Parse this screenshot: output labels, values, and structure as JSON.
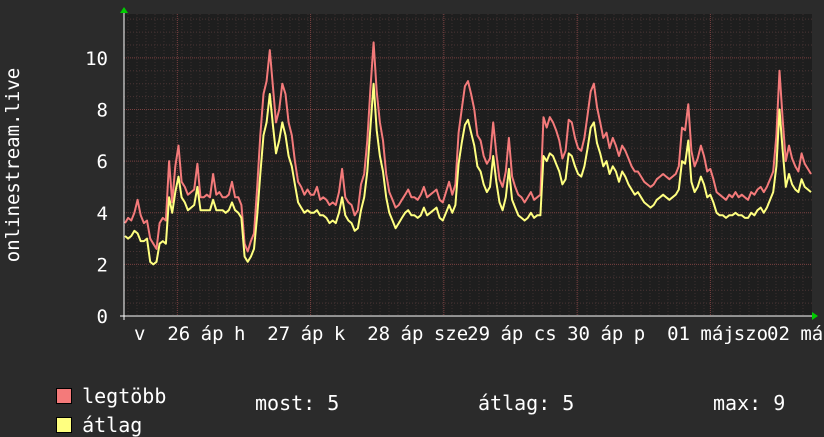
{
  "chart_data": {
    "type": "line",
    "ylabel": "onlinestream.live",
    "ylim": [
      0,
      11.7
    ],
    "yticks": [
      0,
      2,
      4,
      6,
      8,
      10
    ],
    "x_ticks": [
      "v",
      "26",
      "áp",
      "h",
      "27",
      "áp",
      "k",
      "28",
      "áp",
      "sze",
      "29",
      "áp",
      "cs",
      "30",
      "áp",
      "p",
      "01",
      "máj",
      "szo",
      "02",
      "má"
    ],
    "grid": true,
    "legend_position": "bottom-left",
    "series": [
      {
        "name": "legtöbb",
        "color": "#f47a7a",
        "values": [
          3.6,
          3.8,
          3.7,
          4.0,
          4.5,
          3.9,
          3.6,
          3.7,
          3.0,
          2.8,
          2.6,
          3.6,
          3.8,
          3.7,
          6.0,
          4.4,
          5.8,
          6.6,
          5.2,
          5.0,
          4.7,
          4.8,
          4.9,
          5.9,
          4.6,
          4.6,
          4.7,
          4.6,
          5.5,
          4.7,
          4.8,
          4.6,
          4.6,
          4.7,
          5.2,
          4.6,
          4.6,
          4.3,
          2.8,
          2.5,
          2.9,
          3.2,
          5.0,
          7.0,
          8.6,
          9.1,
          10.3,
          8.9,
          7.5,
          8.0,
          9.0,
          8.6,
          7.5,
          7.0,
          6.0,
          5.2,
          5.0,
          4.7,
          4.9,
          4.7,
          4.7,
          5.0,
          4.5,
          4.6,
          4.5,
          4.3,
          4.4,
          4.3,
          4.8,
          5.7,
          4.6,
          4.4,
          4.3,
          3.9,
          4.1,
          5.1,
          5.5,
          6.8,
          8.8,
          10.6,
          8.7,
          7.5,
          6.8,
          5.5,
          4.8,
          4.5,
          4.2,
          4.3,
          4.5,
          4.7,
          4.9,
          4.6,
          4.6,
          4.5,
          4.7,
          5.0,
          4.6,
          4.7,
          4.8,
          4.9,
          4.5,
          4.4,
          4.8,
          5.2,
          4.7,
          5.1,
          7.1,
          8.0,
          8.9,
          9.1,
          8.6,
          8.0,
          7.0,
          6.8,
          6.2,
          5.9,
          6.1,
          7.5,
          6.3,
          5.3,
          5.0,
          5.6,
          6.9,
          5.4,
          5.0,
          4.7,
          4.6,
          4.4,
          4.6,
          4.8,
          4.5,
          4.6,
          4.7,
          7.7,
          7.3,
          7.7,
          7.5,
          7.2,
          6.8,
          6.1,
          6.4,
          7.6,
          7.5,
          6.9,
          6.5,
          6.4,
          6.9,
          7.8,
          8.7,
          9.0,
          8.1,
          7.5,
          6.9,
          7.1,
          6.5,
          6.9,
          6.6,
          6.2,
          6.6,
          6.4,
          6.1,
          5.8,
          5.6,
          5.6,
          5.4,
          5.2,
          5.1,
          5.0,
          5.1,
          5.3,
          5.4,
          5.5,
          5.4,
          5.3,
          5.4,
          5.5,
          5.8,
          7.3,
          7.2,
          8.2,
          6.4,
          5.8,
          6.1,
          6.6,
          6.2,
          5.6,
          5.7,
          5.3,
          4.8,
          4.7,
          4.6,
          4.5,
          4.7,
          4.6,
          4.8,
          4.6,
          4.7,
          4.6,
          4.5,
          4.8,
          4.7,
          4.9,
          5.0,
          4.8,
          5.0,
          5.3,
          5.6,
          7.0,
          9.5,
          7.6,
          6.0,
          6.6,
          6.1,
          5.8,
          5.6,
          6.3,
          5.9,
          5.7,
          5.5
        ]
      },
      {
        "name": "átlag",
        "color": "#ffff80",
        "values": [
          3.1,
          3.0,
          3.1,
          3.3,
          3.2,
          2.9,
          2.9,
          3.0,
          2.1,
          2.0,
          2.1,
          2.8,
          2.9,
          2.8,
          4.6,
          4.0,
          4.8,
          5.4,
          4.6,
          4.4,
          4.1,
          4.2,
          4.3,
          5.0,
          4.1,
          4.1,
          4.1,
          4.1,
          4.5,
          4.1,
          4.1,
          4.1,
          4.0,
          4.1,
          4.4,
          4.1,
          4.0,
          3.8,
          2.3,
          2.1,
          2.3,
          2.6,
          3.9,
          5.5,
          7.0,
          7.5,
          8.6,
          7.4,
          6.3,
          6.8,
          7.5,
          7.0,
          6.2,
          5.8,
          5.1,
          4.4,
          4.2,
          4.0,
          4.1,
          4.0,
          4.0,
          4.1,
          3.9,
          3.9,
          3.8,
          3.6,
          3.7,
          3.6,
          4.0,
          4.6,
          3.9,
          3.7,
          3.6,
          3.3,
          3.4,
          4.1,
          4.6,
          5.6,
          7.3,
          9.0,
          7.2,
          6.2,
          5.6,
          4.6,
          4.0,
          3.7,
          3.4,
          3.6,
          3.8,
          4.0,
          4.1,
          3.9,
          3.9,
          3.8,
          3.9,
          4.2,
          3.9,
          4.0,
          4.1,
          4.2,
          3.8,
          3.7,
          4.0,
          4.3,
          4.0,
          4.3,
          5.9,
          6.7,
          7.4,
          7.6,
          7.1,
          6.6,
          5.8,
          5.6,
          5.1,
          4.8,
          5.0,
          6.2,
          5.2,
          4.4,
          4.1,
          4.6,
          5.7,
          4.5,
          4.2,
          3.9,
          3.8,
          3.7,
          3.8,
          4.0,
          3.8,
          3.9,
          3.9,
          6.2,
          6.0,
          6.3,
          6.2,
          5.9,
          5.6,
          5.1,
          5.3,
          6.3,
          6.2,
          5.8,
          5.5,
          5.4,
          5.8,
          6.5,
          7.3,
          7.5,
          6.7,
          6.3,
          5.8,
          6.0,
          5.5,
          5.8,
          5.6,
          5.2,
          5.6,
          5.4,
          5.1,
          4.9,
          4.7,
          4.8,
          4.6,
          4.4,
          4.3,
          4.2,
          4.3,
          4.5,
          4.6,
          4.7,
          4.6,
          4.5,
          4.6,
          4.7,
          4.9,
          6.0,
          5.9,
          6.8,
          5.2,
          4.8,
          5.0,
          5.4,
          5.1,
          4.6,
          4.7,
          4.4,
          4.0,
          3.9,
          3.9,
          3.8,
          3.9,
          3.9,
          4.0,
          3.9,
          3.9,
          3.8,
          3.8,
          4.0,
          3.9,
          4.1,
          4.2,
          4.0,
          4.2,
          4.5,
          4.8,
          5.8,
          8.0,
          6.4,
          5.0,
          5.5,
          5.1,
          4.9,
          4.8,
          5.3,
          5.0,
          4.9,
          4.8
        ]
      }
    ]
  },
  "legend": {
    "items": [
      {
        "label": "legtöbb",
        "color": "#f47a7a"
      },
      {
        "label": "átlag",
        "color": "#ffff80"
      }
    ]
  },
  "stats": {
    "current": "most: 5",
    "average": "átlag: 5",
    "max": "max: 9"
  }
}
